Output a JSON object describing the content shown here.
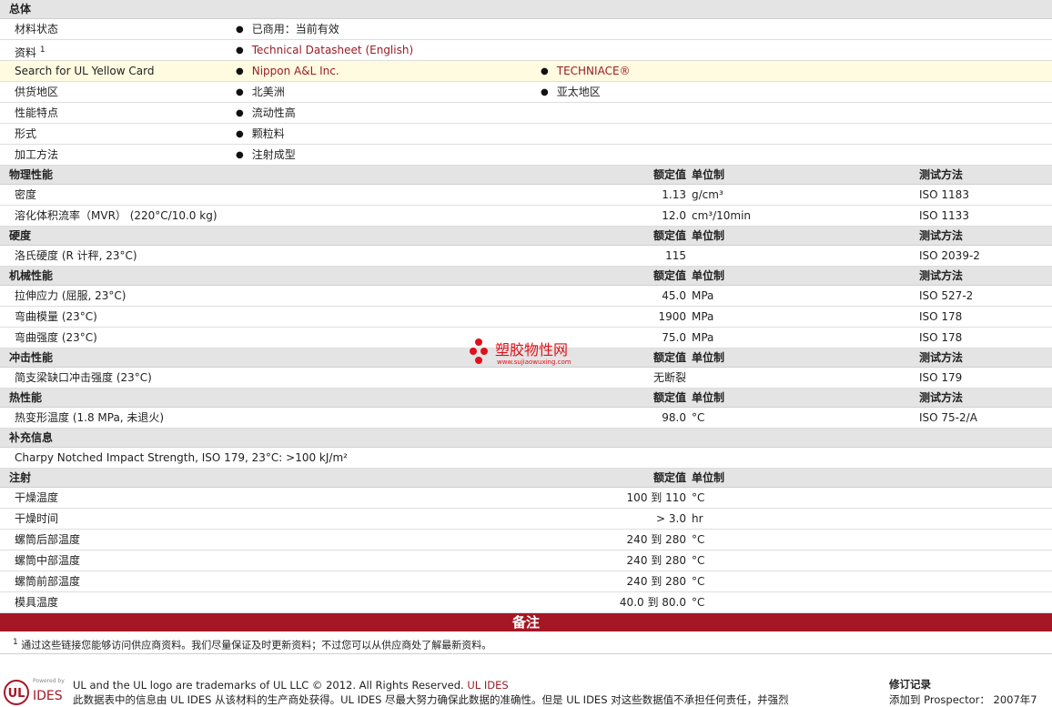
{
  "general": {
    "title": "总体",
    "rows": [
      {
        "label": "材料状态",
        "c1": "已商用：当前有效"
      },
      {
        "label": "资料",
        "sup": "1",
        "c1": "Technical Datasheet (English)",
        "c1link": true
      },
      {
        "label": "Search for UL Yellow Card",
        "c1": "Nippon A&L Inc.",
        "c1link": true,
        "c2": "TECHNIACE®",
        "c2link": true,
        "highlight": true
      },
      {
        "label": "供货地区",
        "c1": "北美洲",
        "c2": "亚太地区"
      },
      {
        "label": "性能特点",
        "c1": "流动性高"
      },
      {
        "label": "形式",
        "c1": "颗粒料"
      },
      {
        "label": "加工方法",
        "c1": "注射成型"
      }
    ]
  },
  "col_headers": {
    "rated": "额定值",
    "unit": "单位制",
    "method": "测试方法"
  },
  "sections": [
    {
      "title": "物理性能",
      "rows": [
        {
          "label": "密度",
          "value": "1.13",
          "unit": "g/cm³",
          "method": "ISO 1183"
        },
        {
          "label": "溶化体积流率（MVR） (220°C/10.0 kg)",
          "value": "12.0",
          "unit": "cm³/10min",
          "method": "ISO 1133"
        }
      ]
    },
    {
      "title": "硬度",
      "rows": [
        {
          "label": "洛氏硬度 (R 计秤, 23°C)",
          "value": "115",
          "unit": "",
          "method": "ISO 2039-2"
        }
      ]
    },
    {
      "title": "机械性能",
      "rows": [
        {
          "label": "拉伸应力 (屈服, 23°C)",
          "value": "45.0",
          "unit": "MPa",
          "method": "ISO 527-2"
        },
        {
          "label": "弯曲模量 (23°C)",
          "value": "1900",
          "unit": "MPa",
          "method": "ISO 178"
        },
        {
          "label": "弯曲强度 (23°C)",
          "value": "75.0",
          "unit": "MPa",
          "method": "ISO 178"
        }
      ]
    },
    {
      "title": "冲击性能",
      "rows": [
        {
          "label": "简支梁缺口冲击强度 (23°C)",
          "value": "无断裂",
          "unit": "",
          "method": "ISO 179"
        }
      ]
    },
    {
      "title": "热性能",
      "rows": [
        {
          "label": "热变形温度 (1.8 MPa, 未退火)",
          "value": "98.0",
          "unit": "°C",
          "method": "ISO 75-2/A"
        }
      ]
    }
  ],
  "supplement": {
    "title": "补充信息",
    "text": "Charpy Notched Impact Strength, ISO 179, 23°C: >100 kJ/m²"
  },
  "injection": {
    "title": "注射",
    "rows": [
      {
        "label": "干燥温度",
        "value": "100 到  110",
        "unit": "°C"
      },
      {
        "label": "干燥时间",
        "value": "> 3.0",
        "unit": "hr"
      },
      {
        "label": "螺筒后部温度",
        "value": "240 到  280",
        "unit": "°C"
      },
      {
        "label": "螺筒中部温度",
        "value": "240 到  280",
        "unit": "°C"
      },
      {
        "label": "螺筒前部温度",
        "value": "240 到  280",
        "unit": "°C"
      },
      {
        "label": "模具温度",
        "value": "40.0 到  80.0",
        "unit": "°C"
      }
    ]
  },
  "notes": {
    "title": "备注",
    "sup": "1",
    "text": "通过这些链接您能够访问供应商资料。我们尽量保证及时更新资料；不过您可以从供应商处了解最新资料。"
  },
  "watermark": {
    "cn": "塑胶物性网",
    "url": "www.sujiaowuxing.com"
  },
  "footer": {
    "line1": "UL and the UL logo are trademarks of UL LLC © 2012. All Rights Reserved.",
    "line1_link": "UL IDES",
    "line2": "此数据表中的信息由  UL IDES 从该材料的生产商处获得。UL IDES 尽最大努力确保此数据的准确性。但是  UL IDES 对这些数据值不承担任何责任，并强烈",
    "revision_title": "修订记录",
    "revision_text": "添加到  Prospector： 2007年7",
    "logo_small": "Powered by",
    "logo_ul": "UL",
    "logo_ides": "IDES"
  },
  "colors": {
    "accent": "#a51725",
    "link": "#9a1d26",
    "highlight": "#fffbe0",
    "header_bg": "#e4e4e4"
  }
}
